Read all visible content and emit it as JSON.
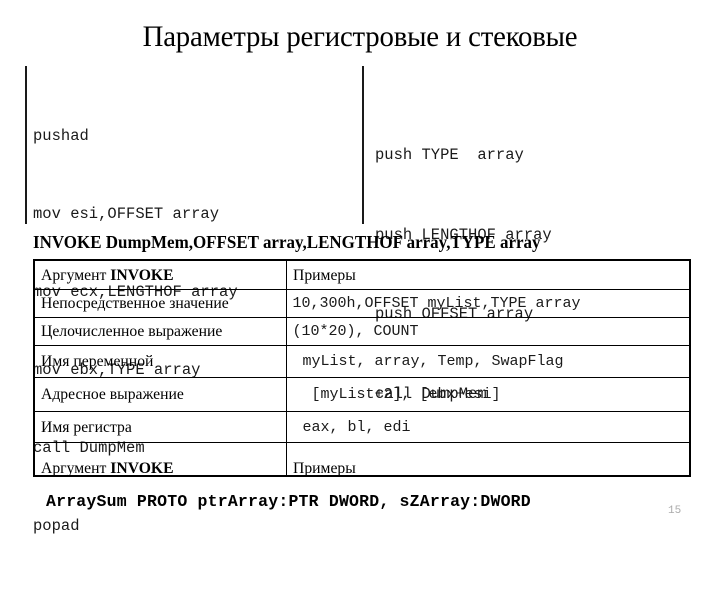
{
  "slide": {
    "title": "Параметры регистровые и стековые",
    "page_number": "15"
  },
  "code_blocks": {
    "left": {
      "lines": [
        "pushad",
        "mov esi,OFFSET array",
        "mov ecx,LENGTHOF array",
        "mov ebx,TYPE array",
        "call DumpMem",
        "popad"
      ]
    },
    "right": {
      "lines": [
        "push TYPE  array",
        "push LENGTHOF array",
        "push OFFSET array",
        "call DumpMem"
      ]
    }
  },
  "invoke_caption": "INVOKE DumpMem,OFFSET array,LENGTHOF array,TYPE array",
  "table": {
    "headers": [
      "Аргумент INVOKE",
      "Примеры"
    ],
    "header_label_plain": "Аргумент ",
    "header_label_bold": "INVOKE",
    "rows": [
      {
        "label": "Непосредственное значение",
        "example": "10,300h,OFFSET myList,TYPE array"
      },
      {
        "label": "Целочисленное выражение",
        "example": "(10*20), COUNT"
      },
      {
        "label": "Имя переменной",
        "example": "myList, array, Temp, SwapFlag"
      },
      {
        "label": "Адресное выражение",
        "example": "[myList+2], [ebx+esi]"
      },
      {
        "label": "Имя регистра",
        "example": "eax, bl, edi"
      }
    ],
    "repeat_header": {
      "label_plain": "Аргумент ",
      "label_bold": "INVOKE",
      "example": "Примеры"
    }
  },
  "proto_line": "ArraySum PROTO ptrArray:PTR DWORD, sZArray:DWORD",
  "colors": {
    "text": "#000000",
    "code_text": "#1a1a1a",
    "rule": "#1a1a1a",
    "page_number": "#aaaaaa",
    "background": "#ffffff"
  }
}
